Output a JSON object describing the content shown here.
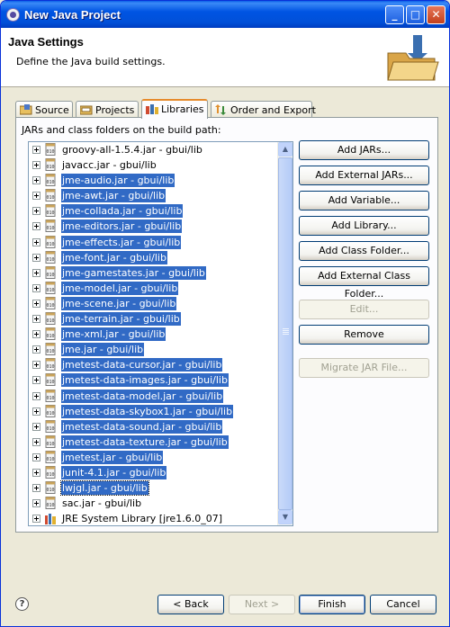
{
  "window": {
    "title": "New Java Project"
  },
  "title_buttons": {
    "minimize": "_",
    "maximize": "□",
    "close": "✕"
  },
  "header": {
    "title": "Java Settings",
    "description": "Define the Java build settings."
  },
  "tabs": [
    {
      "label": "Source",
      "icon": "source-folder-icon",
      "active": false
    },
    {
      "label": "Projects",
      "icon": "projects-folder-icon",
      "active": false
    },
    {
      "label": "Libraries",
      "icon": "libraries-icon",
      "active": true
    },
    {
      "label": "Order and Export",
      "icon": "order-export-icon",
      "active": false
    }
  ],
  "libraries": {
    "section_label": "JARs and class folders on the build path:",
    "items": [
      {
        "label": "groovy-all-1.5.4.jar - gbui/lib",
        "selected": false
      },
      {
        "label": "javacc.jar - gbui/lib",
        "selected": false
      },
      {
        "label": "jme-audio.jar - gbui/lib",
        "selected": true
      },
      {
        "label": "jme-awt.jar - gbui/lib",
        "selected": true
      },
      {
        "label": "jme-collada.jar - gbui/lib",
        "selected": true
      },
      {
        "label": "jme-editors.jar - gbui/lib",
        "selected": true
      },
      {
        "label": "jme-effects.jar - gbui/lib",
        "selected": true
      },
      {
        "label": "jme-font.jar - gbui/lib",
        "selected": true
      },
      {
        "label": "jme-gamestates.jar - gbui/lib",
        "selected": true
      },
      {
        "label": "jme-model.jar - gbui/lib",
        "selected": true
      },
      {
        "label": "jme-scene.jar - gbui/lib",
        "selected": true
      },
      {
        "label": "jme-terrain.jar - gbui/lib",
        "selected": true
      },
      {
        "label": "jme-xml.jar - gbui/lib",
        "selected": true
      },
      {
        "label": "jme.jar - gbui/lib",
        "selected": true
      },
      {
        "label": "jmetest-data-cursor.jar - gbui/lib",
        "selected": true
      },
      {
        "label": "jmetest-data-images.jar - gbui/lib",
        "selected": true
      },
      {
        "label": "jmetest-data-model.jar - gbui/lib",
        "selected": true
      },
      {
        "label": "jmetest-data-skybox1.jar - gbui/lib",
        "selected": true
      },
      {
        "label": "jmetest-data-sound.jar - gbui/lib",
        "selected": true
      },
      {
        "label": "jmetest-data-texture.jar - gbui/lib",
        "selected": true
      },
      {
        "label": "jmetest.jar - gbui/lib",
        "selected": true
      },
      {
        "label": "junit-4.1.jar - gbui/lib",
        "selected": true
      },
      {
        "label": "lwjgl.jar - gbui/lib",
        "selected": true,
        "focused": true
      },
      {
        "label": "sac.jar - gbui/lib",
        "selected": false
      },
      {
        "label": "JRE System Library [jre1.6.0_07]",
        "selected": false,
        "icon": "jre-library-icon"
      }
    ]
  },
  "side_buttons": [
    {
      "label": "Add JARs...",
      "enabled": true
    },
    {
      "label": "Add External JARs...",
      "enabled": true
    },
    {
      "label": "Add Variable...",
      "enabled": true
    },
    {
      "label": "Add Library...",
      "enabled": true
    },
    {
      "label": "Add Class Folder...",
      "enabled": true
    },
    {
      "label": "Add External Class Folder...",
      "enabled": true
    },
    {
      "label": "Edit...",
      "enabled": false
    },
    {
      "label": "Remove",
      "enabled": true
    },
    {
      "label": "Migrate JAR File...",
      "enabled": false
    }
  ],
  "footer": {
    "help": "?",
    "back": "< Back",
    "next": "Next >",
    "finish": "Finish",
    "cancel": "Cancel"
  },
  "colors": {
    "selection": "#316ac5",
    "titlebar": "#0054e3",
    "tab_highlight": "#e68b2c"
  }
}
